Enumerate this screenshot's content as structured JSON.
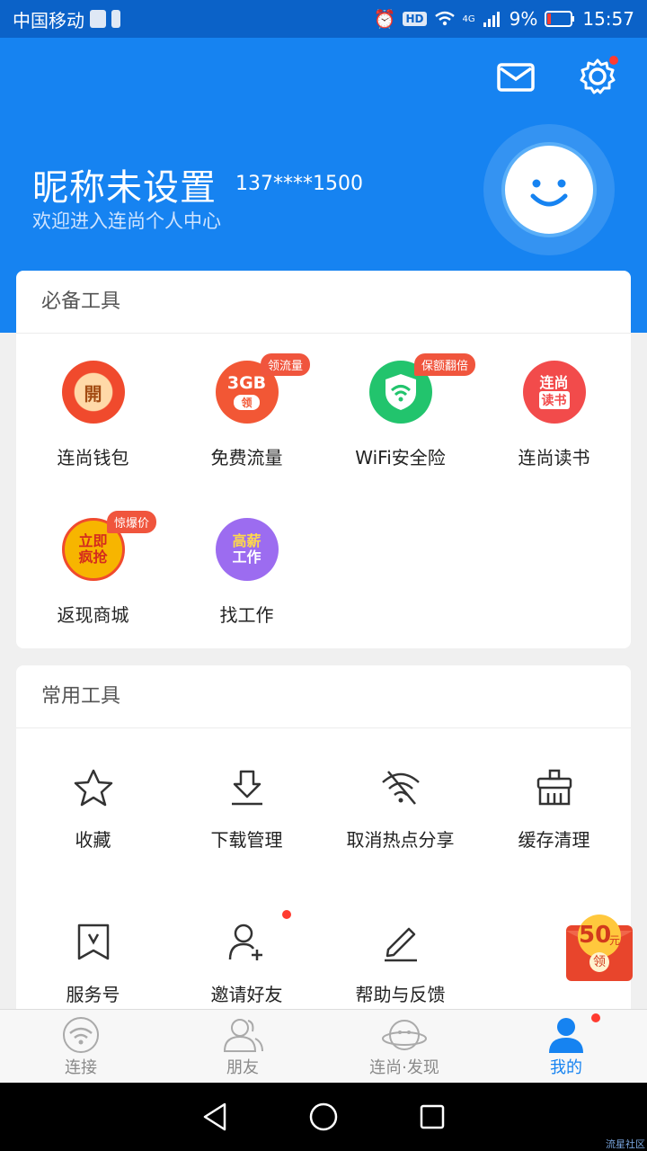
{
  "status_bar": {
    "carrier": "中国移动",
    "battery": "9%",
    "time": "15:57",
    "network": "4G"
  },
  "header": {
    "nickname": "昵称未设置",
    "phone": "137****1500",
    "welcome": "欢迎进入连尚个人中心",
    "bg_color": "#1683f1"
  },
  "essential": {
    "title": "必备工具",
    "items": [
      {
        "label": "连尚钱包",
        "icon_text": "開",
        "icon": "wallet-icon",
        "color": "#f04a2d",
        "badge": ""
      },
      {
        "label": "免费流量",
        "icon_text": "3GB",
        "icon_sub": "领",
        "icon": "data-traffic-icon",
        "color": "#f25735",
        "badge": "领流量"
      },
      {
        "label": "WiFi安全险",
        "icon_text": "",
        "icon": "wifi-shield-icon",
        "color": "#22c46d",
        "badge": "保额翻倍"
      },
      {
        "label": "连尚读书",
        "icon_text": "连尚",
        "icon_sub": "读书",
        "icon": "reading-icon",
        "color": "#f24b4b",
        "badge": ""
      },
      {
        "label": "返现商城",
        "icon_text": "立即",
        "icon_sub": "疯抢",
        "icon": "mall-icon",
        "color": "#f7b500",
        "badge": "惊爆价"
      },
      {
        "label": "找工作",
        "icon_text": "高薪",
        "icon_sub": "工作",
        "icon": "job-icon",
        "color": "#9c6cf0",
        "badge": ""
      }
    ]
  },
  "common": {
    "title": "常用工具",
    "items": [
      {
        "label": "收藏",
        "icon": "star-icon"
      },
      {
        "label": "下载管理",
        "icon": "download-icon"
      },
      {
        "label": "取消热点分享",
        "icon": "wifi-off-icon"
      },
      {
        "label": "缓存清理",
        "icon": "broom-icon"
      },
      {
        "label": "服务号",
        "icon": "bookmark-v-icon"
      },
      {
        "label": "邀请好友",
        "icon": "add-user-icon"
      },
      {
        "label": "帮助与反馈",
        "icon": "pencil-icon"
      }
    ]
  },
  "red_packet": {
    "amount": "50",
    "unit": "元",
    "label": "领"
  },
  "tabbar": {
    "items": [
      {
        "label": "连接",
        "icon": "wifi-tab-icon"
      },
      {
        "label": "朋友",
        "icon": "friends-tab-icon"
      },
      {
        "label": "连尚·发现",
        "icon": "planet-tab-icon"
      },
      {
        "label": "我的",
        "icon": "me-tab-icon"
      }
    ]
  },
  "watermark": "流星社区"
}
